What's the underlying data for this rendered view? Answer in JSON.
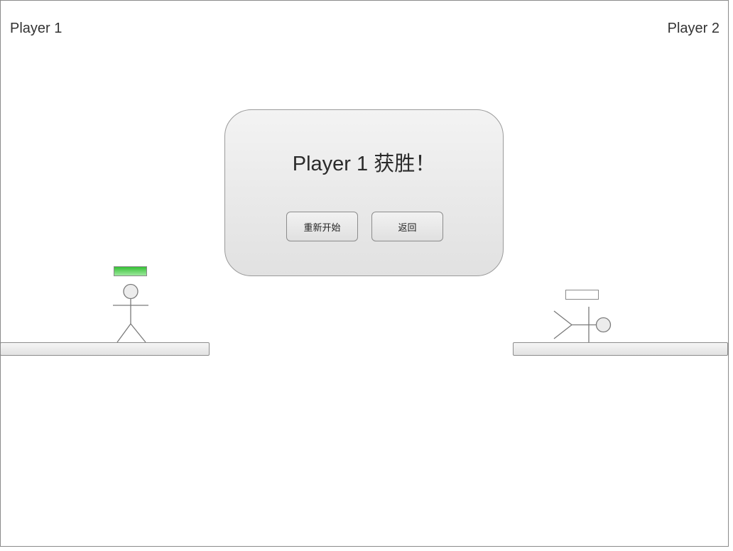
{
  "players": {
    "p1": {
      "label": "Player 1",
      "health": 1.0
    },
    "p2": {
      "label": "Player 2",
      "health": 0.0
    }
  },
  "dialog": {
    "title": "Player 1 获胜！",
    "restart_label": "重新开始",
    "back_label": "返回"
  },
  "colors": {
    "health_fill": "#36c136",
    "outline": "#8a8a8a"
  }
}
